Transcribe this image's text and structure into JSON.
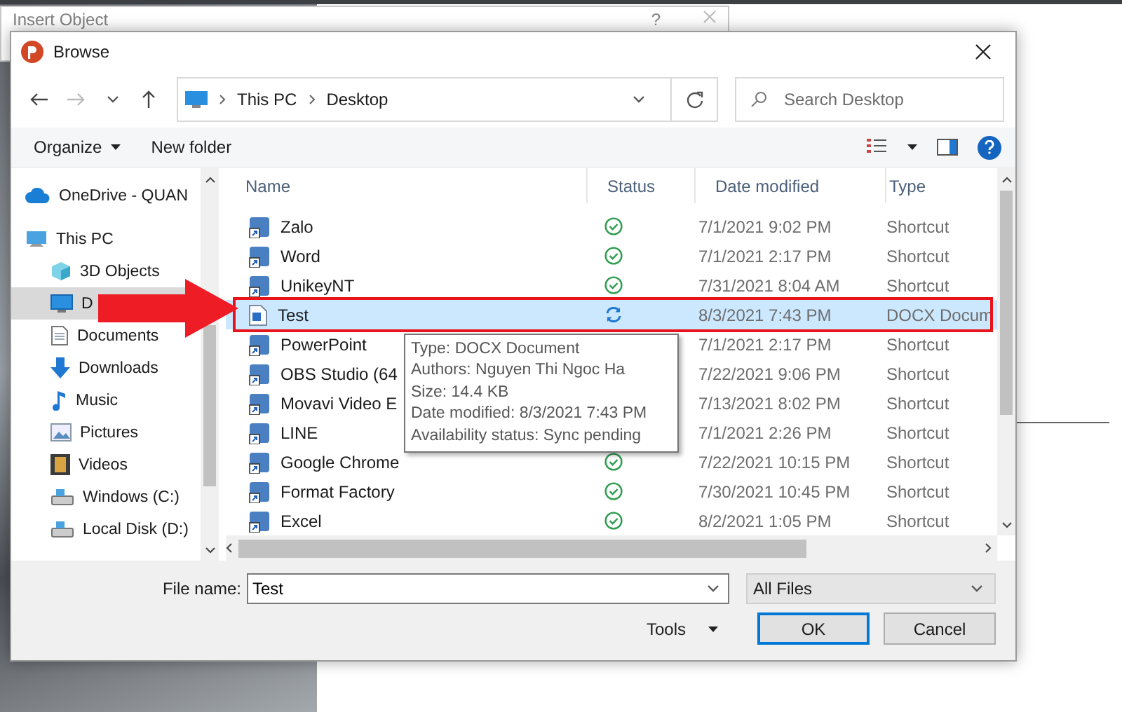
{
  "background_window": {
    "title": "Insert Object",
    "help": "?"
  },
  "window": {
    "title": "Browse"
  },
  "address": {
    "crumbs": [
      "This PC",
      "Desktop"
    ],
    "search_placeholder": "Search Desktop"
  },
  "toolbar": {
    "organize": "Organize",
    "new_folder": "New folder"
  },
  "sidebar": {
    "items": [
      {
        "label": "OneDrive - QUAN",
        "kind": "cloud",
        "selected": false
      },
      {
        "label": "This PC",
        "kind": "computer",
        "selected": false,
        "children": [
          {
            "label": "3D Objects",
            "kind": "cube",
            "selected": false
          },
          {
            "label": "D",
            "kind": "desktop",
            "selected": true
          },
          {
            "label": "Documents",
            "kind": "document",
            "selected": false
          },
          {
            "label": "Downloads",
            "kind": "download",
            "selected": false
          },
          {
            "label": "Music",
            "kind": "music",
            "selected": false
          },
          {
            "label": "Pictures",
            "kind": "picture",
            "selected": false
          },
          {
            "label": "Videos",
            "kind": "video",
            "selected": false
          },
          {
            "label": "Windows (C:)",
            "kind": "drive",
            "selected": false
          },
          {
            "label": "Local Disk (D:)",
            "kind": "drive",
            "selected": false
          }
        ]
      }
    ]
  },
  "table": {
    "columns": [
      "Name",
      "Status",
      "Date modified",
      "Type"
    ],
    "rows": [
      {
        "name": "Zalo",
        "kind": "shortcut",
        "synced": true,
        "date": "7/1/2021 9:02 PM",
        "type": "Shortcut",
        "selected": false
      },
      {
        "name": "Word",
        "kind": "shortcut",
        "synced": true,
        "date": "7/1/2021 2:17 PM",
        "type": "Shortcut",
        "selected": false
      },
      {
        "name": "UnikeyNT",
        "kind": "shortcut",
        "synced": true,
        "date": "7/31/2021 8:04 AM",
        "type": "Shortcut",
        "selected": false
      },
      {
        "name": "Test",
        "kind": "document",
        "synced": false,
        "date": "8/3/2021 7:43 PM",
        "type": "DOCX Docum",
        "selected": true
      },
      {
        "name": "PowerPoint",
        "kind": "shortcut",
        "date": "7/1/2021 2:17 PM",
        "type": "Shortcut",
        "selected": false
      },
      {
        "name": "OBS Studio (64",
        "kind": "shortcut",
        "date": "7/22/2021 9:06 PM",
        "type": "Shortcut",
        "selected": false
      },
      {
        "name": "Movavi Video E",
        "kind": "shortcut",
        "date": "7/13/2021 8:02 PM",
        "type": "Shortcut",
        "selected": false
      },
      {
        "name": "LINE",
        "kind": "shortcut",
        "date": "7/1/2021 2:26 PM",
        "type": "Shortcut",
        "selected": false
      },
      {
        "name": "Google Chrome",
        "kind": "shortcut",
        "synced": true,
        "date": "7/22/2021 10:15 PM",
        "type": "Shortcut",
        "selected": false
      },
      {
        "name": "Format Factory",
        "kind": "shortcut",
        "synced": true,
        "date": "7/30/2021 10:45 PM",
        "type": "Shortcut",
        "selected": false
      },
      {
        "name": "Excel",
        "kind": "shortcut",
        "synced": true,
        "date": "8/2/2021 1:05 PM",
        "type": "Shortcut",
        "selected": false
      }
    ]
  },
  "tooltip": {
    "lines": [
      "Type: DOCX Document",
      "Authors: Nguyen Thi Ngoc Ha",
      "Size: 14.4 KB",
      "Date modified: 8/3/2021 7:43 PM",
      "Availability status: Sync pending"
    ]
  },
  "footer": {
    "file_name_label": "File name:",
    "file_name": "Test",
    "file_type": "All Files",
    "tools": "Tools",
    "ok": "OK",
    "cancel": "Cancel"
  }
}
